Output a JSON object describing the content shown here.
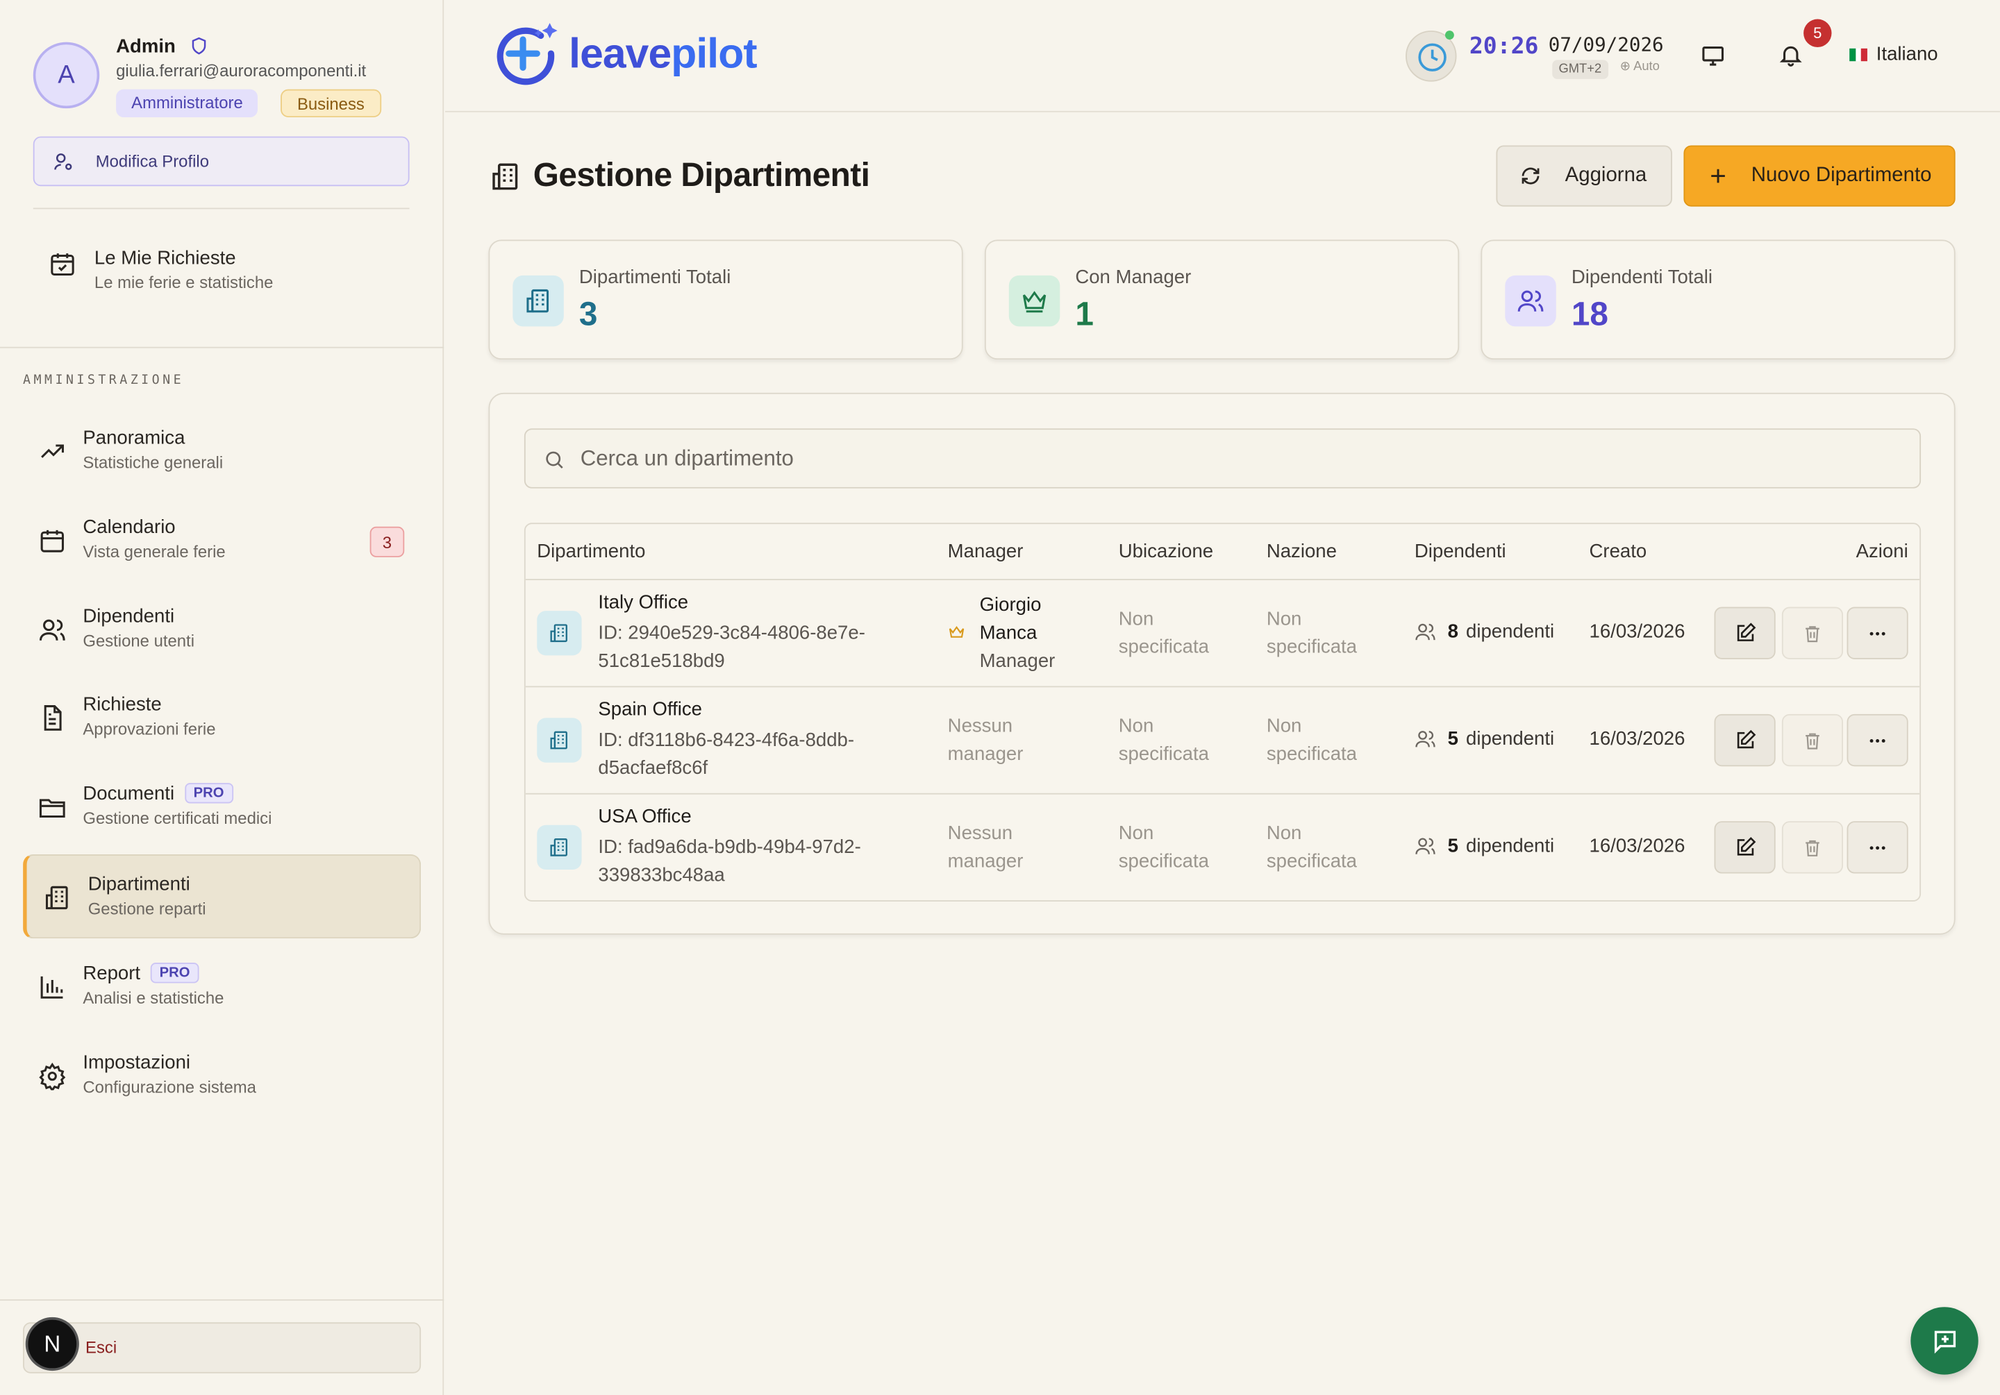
{
  "user": {
    "initial": "A",
    "name": "Admin",
    "email": "giulia.ferrari@auroracomponenti.it",
    "role_badge": "Amministratore",
    "plan_badge": "Business",
    "edit_profile_label": "Modifica Profilo"
  },
  "my_requests": {
    "title": "Le Mie Richieste",
    "subtitle": "Le mie ferie e statistiche"
  },
  "sidebar": {
    "section_label": "AMMINISTRAZIONE",
    "items": [
      {
        "title": "Panoramica",
        "subtitle": "Statistiche generali",
        "icon": "trending-up-icon"
      },
      {
        "title": "Calendario",
        "subtitle": "Vista generale ferie",
        "icon": "calendar-icon",
        "badge": "3"
      },
      {
        "title": "Dipendenti",
        "subtitle": "Gestione utenti",
        "icon": "users-icon"
      },
      {
        "title": "Richieste",
        "subtitle": "Approvazioni ferie",
        "icon": "document-icon"
      },
      {
        "title": "Documenti",
        "subtitle": "Gestione certificati medici",
        "icon": "folder-icon",
        "tag": "PRO"
      },
      {
        "title": "Dipartimenti",
        "subtitle": "Gestione reparti",
        "icon": "building-icon",
        "active": true
      },
      {
        "title": "Report",
        "subtitle": "Analisi e statistiche",
        "icon": "bar-chart-icon",
        "tag": "PRO"
      },
      {
        "title": "Impostazioni",
        "subtitle": "Configurazione sistema",
        "icon": "gear-icon"
      }
    ],
    "logout_label": "Esci",
    "dev_avatar_letter": "N"
  },
  "header": {
    "logo_leave": "leave",
    "logo_pilot": "pilot",
    "time": "20:26",
    "date": "07/09/2026",
    "timezone": "GMT+2",
    "tz_mode": "⊕ Auto",
    "notification_count": "5",
    "language": "Italiano",
    "flag_colors": [
      "#009246",
      "#ffffff",
      "#ce2b37"
    ]
  },
  "page": {
    "title": "Gestione Dipartimenti",
    "refresh_label": "Aggiorna",
    "new_label": "Nuovo Dipartimento"
  },
  "stats": [
    {
      "label": "Dipartimenti Totali",
      "value": "3",
      "color": "#1f6f8b"
    },
    {
      "label": "Con Manager",
      "value": "1",
      "color": "#1e7a4a"
    },
    {
      "label": "Dipendenti Totali",
      "value": "18",
      "color": "#5146c8"
    }
  ],
  "search": {
    "placeholder": "Cerca un dipartimento",
    "value": ""
  },
  "table": {
    "headers": [
      "Dipartimento",
      "Manager",
      "Ubicazione",
      "Nazione",
      "Dipendenti",
      "Creato",
      "Azioni"
    ],
    "rows": [
      {
        "name": "Italy Office",
        "id": "ID: 2940e529-3c84-4806-8e7e-51c81e518bd9",
        "manager_first": "Giorgio",
        "manager_last": "Manca",
        "manager_role": "Manager",
        "location": "Non specificata",
        "country": "Non specificata",
        "employees": "8",
        "employees_label": "dipendenti",
        "created": "16/03/2026"
      },
      {
        "name": "Spain Office",
        "id": "ID: df3118b6-8423-4f6a-8ddb-d5acfaef8c6f",
        "manager_empty": "Nessun manager",
        "location": "Non specificata",
        "country": "Non specificata",
        "employees": "5",
        "employees_label": "dipendenti",
        "created": "16/03/2026"
      },
      {
        "name": "USA Office",
        "id": "ID: fad9a6da-b9db-49b4-97d2-339833bc48aa",
        "manager_empty": "Nessun manager",
        "location": "Non specificata",
        "country": "Non specificata",
        "employees": "5",
        "employees_label": "dipendenti",
        "created": "16/03/2026"
      }
    ]
  },
  "accent_color": "#f6a824"
}
